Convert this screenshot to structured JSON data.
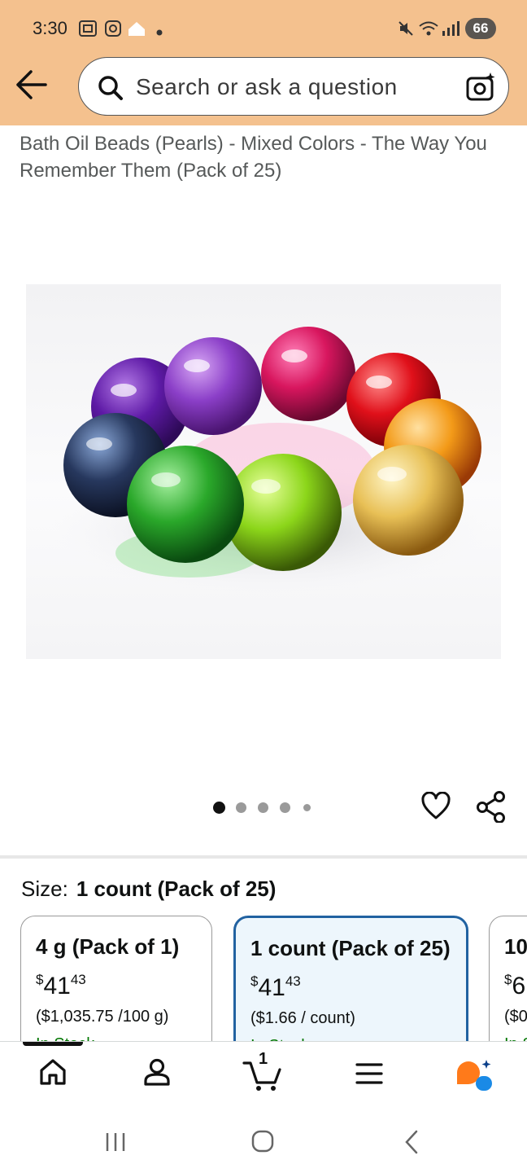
{
  "status_bar": {
    "time": "3:30",
    "battery": "66"
  },
  "header": {
    "search_placeholder": "Search or ask a question",
    "icons": [
      "back-arrow-icon",
      "search-icon",
      "camera-search-icon"
    ]
  },
  "product": {
    "title": "Bath Oil Beads (Pearls) - Mixed Colors - The Way You Remember Them (Pack of 25)",
    "image_count": 5,
    "active_image_index": 0
  },
  "size_selector": {
    "label": "Size:",
    "selected": "1 count (Pack of 25)",
    "options": [
      {
        "name": "4 g (Pack of 1)",
        "currency": "$",
        "price_whole": "41",
        "price_cents": "43",
        "unit_price": "($1,035.75 /100 g)",
        "stock": "In Stock",
        "selected": false
      },
      {
        "name": "1 count (Pack of 25)",
        "currency": "$",
        "price_whole": "41",
        "price_cents": "43",
        "unit_price": "($1.66 / count)",
        "stock": "In Stock",
        "selected": true
      },
      {
        "name": "10",
        "currency": "$",
        "price_whole": "6",
        "price_cents": "",
        "unit_price": "($0",
        "stock": "In Stock",
        "selected": false
      }
    ]
  },
  "bottom_nav": {
    "items": [
      "home-icon",
      "account-icon",
      "cart-icon",
      "menu-icon",
      "rufus-assistant-icon"
    ],
    "cart_count": "1"
  },
  "colors": {
    "header_bg": "#f4c18e",
    "selected_border": "#2162a1",
    "selected_bg": "#edf6fc",
    "in_stock": "#007600"
  }
}
